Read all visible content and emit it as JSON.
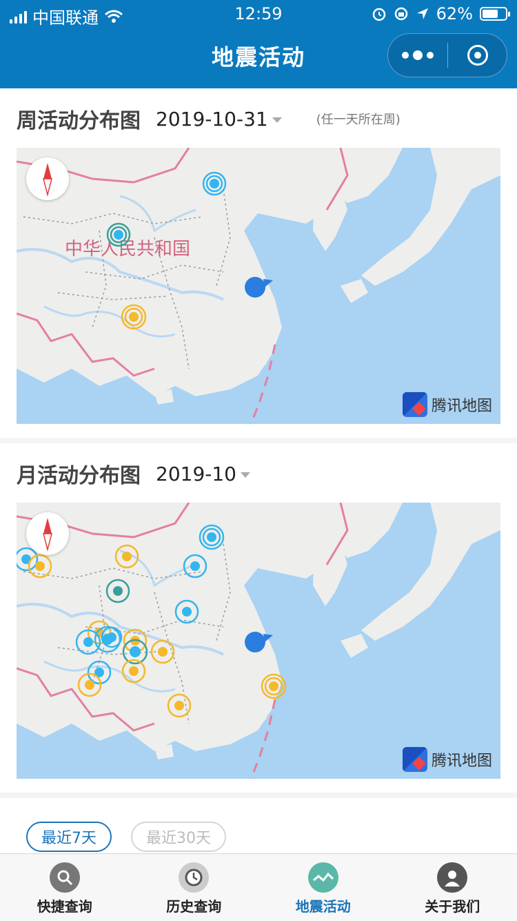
{
  "status_bar": {
    "carrier": "中国联通",
    "time": "12:59",
    "battery": "62%"
  },
  "nav": {
    "title": "地震活动"
  },
  "week_section": {
    "title": "周活动分布图",
    "date": "2019-10-31",
    "note": "(任一天所在周)",
    "map_label": "中华人民共和国",
    "map_logo": "腾讯地图"
  },
  "month_section": {
    "title": "月活动分布图",
    "date": "2019-10",
    "map_logo": "腾讯地图"
  },
  "filters": {
    "recent_7": "最近7天",
    "recent_30": "最近30天"
  },
  "tabbar": {
    "items": [
      {
        "label": "快捷查询",
        "icon": "search-icon"
      },
      {
        "label": "历史查询",
        "icon": "clock-icon"
      },
      {
        "label": "地震活动",
        "icon": "wave-icon"
      },
      {
        "label": "关于我们",
        "icon": "user-icon"
      }
    ],
    "active": 2
  },
  "colors": {
    "nav_bg": "#0a7abf",
    "marker_blue": "#33b5f0",
    "marker_yellow": "#f5b82a",
    "marker_teal": "#3a9f9a",
    "active_tab": "#1a74b8"
  }
}
